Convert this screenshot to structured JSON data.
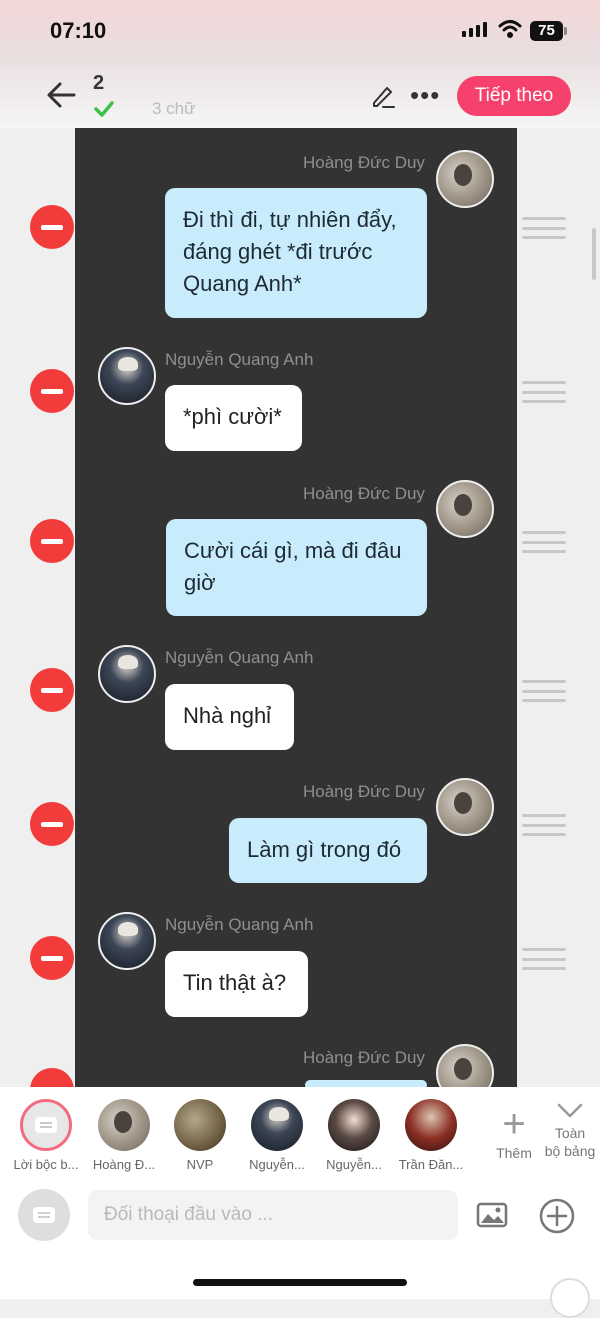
{
  "status_bar": {
    "time": "07:10",
    "battery": "75"
  },
  "header": {
    "count": "2",
    "word_count": "3 chữ",
    "next_label": "Tiếp theo"
  },
  "messages": [
    {
      "side": "right",
      "speaker": "Hoàng Đức Duy",
      "text": "Đi thì đi, tự nhiên đẩy, đáng ghét *đi trước Quang Anh*"
    },
    {
      "side": "left",
      "speaker": "Nguyễn Quang Anh",
      "text": "*phì cười*"
    },
    {
      "side": "right",
      "speaker": "Hoàng Đức Duy",
      "text": "Cười cái gì, mà đi đâu giờ"
    },
    {
      "side": "left",
      "speaker": "Nguyễn Quang Anh",
      "text": "Nhà nghỉ"
    },
    {
      "side": "right",
      "speaker": "Hoàng Đức Duy",
      "text": "Làm gì trong đó"
    },
    {
      "side": "left",
      "speaker": "Nguyễn Quang Anh",
      "text": "Tin thật à?"
    },
    {
      "side": "right",
      "speaker": "Hoàng Đức Duy",
      "text": ""
    }
  ],
  "characters": [
    {
      "label": "Lời bộc b..."
    },
    {
      "label": "Hoàng Đ..."
    },
    {
      "label": "NVP"
    },
    {
      "label": "Nguyễn..."
    },
    {
      "label": "Nguyễn..."
    },
    {
      "label": "Trần Đăn..."
    }
  ],
  "char_actions": {
    "add_label": "Thêm",
    "whole_label_1": "Toàn",
    "whole_label_2": "bộ bảng"
  },
  "input": {
    "placeholder": "Đối thoại đầu vào ..."
  },
  "colors": {
    "accent": "#f6416c",
    "delete": "#f23c3c",
    "bubble_right": "#c8ecfb",
    "chat_bg": "#333333"
  }
}
